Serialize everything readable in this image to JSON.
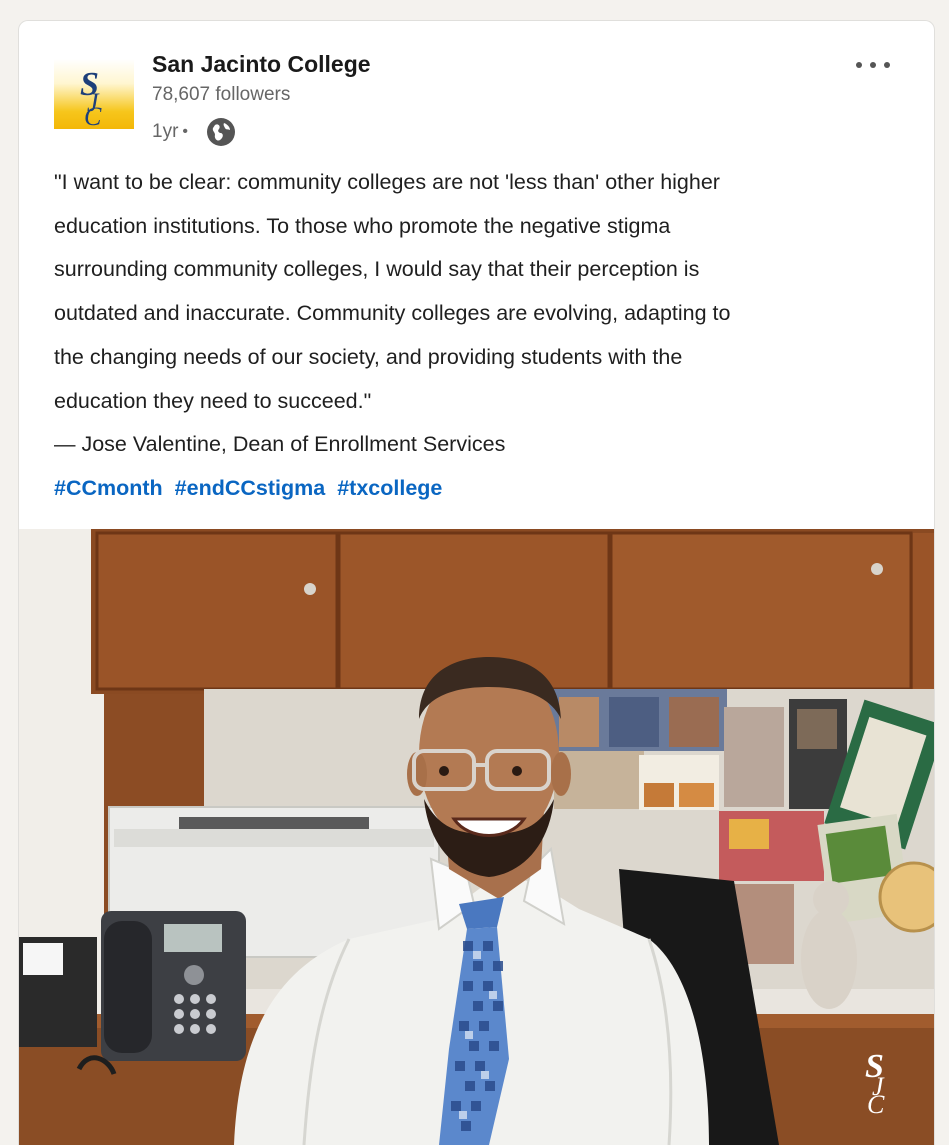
{
  "post": {
    "author": {
      "name": "San Jacinto College",
      "followers": "78,607 followers",
      "time": "1yr",
      "visibility_icon": "globe-icon",
      "logo_icon": "sjc-logo-icon"
    },
    "menu_icon": "more-options-icon",
    "text_lines": [
      "\"I want to be clear: community colleges are not 'less than' other higher",
      "education institutions. To those who promote the negative stigma",
      "surrounding community colleges, I would say that their perception is",
      "outdated and inaccurate. Community colleges are evolving, adapting to",
      "the changing needs of our society, and providing students with the",
      "education they need to succeed.\"",
      "— Jose Valentine, Dean of Enrollment Services"
    ],
    "hashtags": [
      "#CCmonth",
      "#endCCstigma",
      "#txcollege"
    ],
    "image_icon": "office-portrait-photo"
  },
  "colors": {
    "link": "#0a66c2",
    "logo_gold": "#f3b707",
    "logo_blue": "#1d3f7a"
  }
}
